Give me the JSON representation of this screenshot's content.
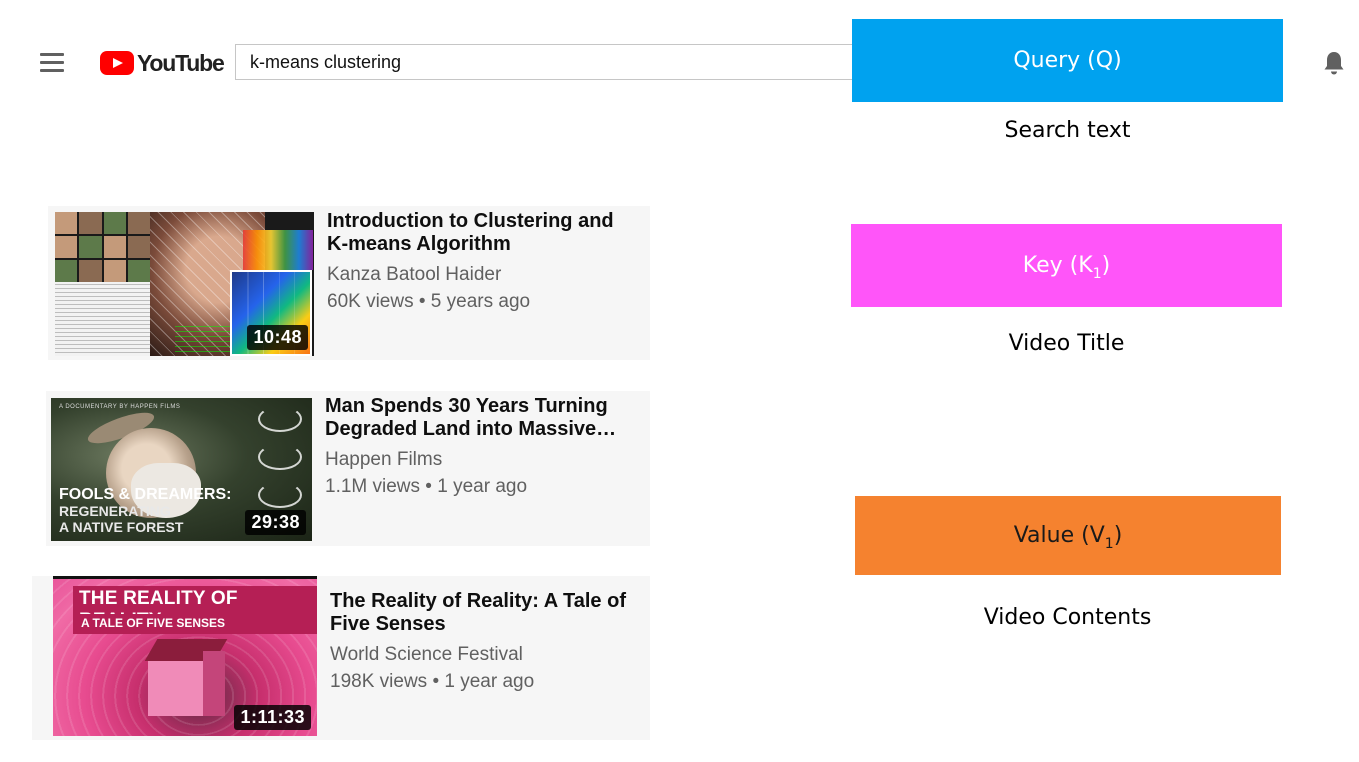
{
  "header": {
    "logo_text": "YouTube",
    "search_value": "k-means clustering"
  },
  "results": [
    {
      "title": "Introduction to Clustering and K-means Algorithm",
      "channel": "Kanza Batool Haider",
      "meta": "60K views • 5 years ago",
      "duration": "10:48"
    },
    {
      "title": "Man Spends 30 Years Turning Degraded Land into Massive…",
      "channel": "Happen Films",
      "meta": "1.1M views • 1 year ago",
      "duration": "29:38",
      "thumb_text": {
        "tag": "A DOCUMENTARY BY HAPPEN FILMS",
        "line1": "FOOLS & DREAMERS:",
        "line2": "REGENERATING",
        "line3": "A NATIVE FOREST"
      }
    },
    {
      "title": "The Reality of Reality: A Tale of Five Senses",
      "channel": "World Science Festival",
      "meta": "198K views • 1 year ago",
      "duration": "1:11:33",
      "thumb_text": {
        "line1": "THE REALITY OF REALITY:",
        "line2": "A TALE OF FIVE SENSES"
      }
    }
  ],
  "annotations": {
    "query": {
      "label": "Query (Q)",
      "caption": "Search text",
      "color": "#00a2ef"
    },
    "key": {
      "label": "Key (K",
      "subscript": "1",
      "label_end": ")",
      "caption": "Video Title",
      "color": "#ff55f9"
    },
    "value": {
      "label": "Value (V",
      "subscript": "1",
      "label_end": ")",
      "caption": "Video Contents",
      "color": "#f5822f"
    }
  }
}
